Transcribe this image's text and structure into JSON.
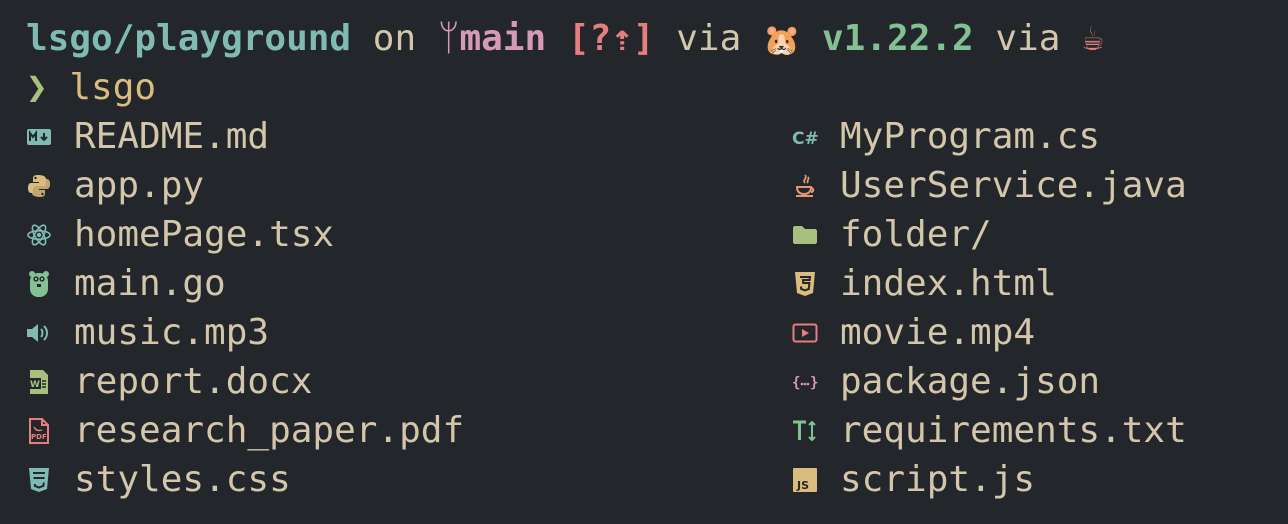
{
  "prompt": {
    "path": "lsgo/playground",
    "on": "on",
    "branch_glyph": "ᛘ",
    "branch": "main",
    "status": "[?⇡]",
    "via1": "via",
    "go_emoji": "🐹",
    "go_version": "v1.22.2",
    "via2": "via",
    "java_emoji": "☕"
  },
  "command": {
    "arrow": "❯",
    "text": "lsgo"
  },
  "colors": {
    "background": "#23272b",
    "text": "#d3c6aa",
    "path": "#7fbbb3",
    "branch": "#d699b6",
    "status": "#e67e80",
    "version": "#83c092",
    "prompt_arrow": "#a7c080"
  },
  "files": [
    {
      "name": "README.md",
      "icon": "markdown-icon",
      "color": "#7fbbb3"
    },
    {
      "name": "MyProgram.cs",
      "icon": "csharp-icon",
      "color": "#7fbbb3"
    },
    {
      "name": "app.py",
      "icon": "python-icon",
      "color": "#dbbc7f"
    },
    {
      "name": "UserService.java",
      "icon": "java-icon",
      "color": "#e69875"
    },
    {
      "name": "homePage.tsx",
      "icon": "react-icon",
      "color": "#7fbbb3"
    },
    {
      "name": "folder/",
      "icon": "folder-icon",
      "color": "#a7c080"
    },
    {
      "name": "main.go",
      "icon": "gopher-icon",
      "color": "#83c092"
    },
    {
      "name": "index.html",
      "icon": "html5-icon",
      "color": "#dbbc7f"
    },
    {
      "name": "music.mp3",
      "icon": "audio-icon",
      "color": "#7fbbb3"
    },
    {
      "name": "movie.mp4",
      "icon": "video-icon",
      "color": "#e67e80"
    },
    {
      "name": "report.docx",
      "icon": "word-doc-icon",
      "color": "#a7c080"
    },
    {
      "name": "package.json",
      "icon": "json-icon",
      "color": "#d699b6"
    },
    {
      "name": "research_paper.pdf",
      "icon": "pdf-icon",
      "color": "#e67e80"
    },
    {
      "name": "requirements.txt",
      "icon": "text-file-icon",
      "color": "#83c092"
    },
    {
      "name": "styles.css",
      "icon": "css3-icon",
      "color": "#7fbbb3"
    },
    {
      "name": "script.js",
      "icon": "javascript-icon",
      "color": "#dbbc7f"
    }
  ]
}
